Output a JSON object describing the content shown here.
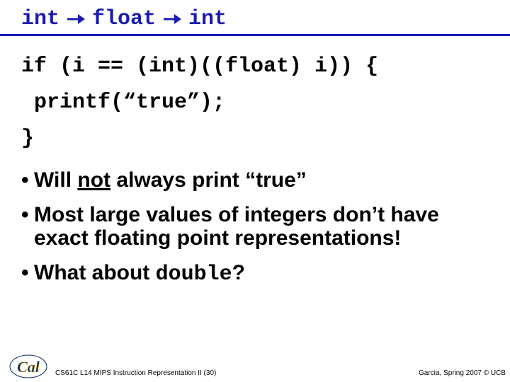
{
  "title": {
    "t1": "int",
    "t2": "float",
    "t3": "int"
  },
  "code": {
    "l1": "if (i == (int)((float) i)) {",
    "l2": "printf(“true”);",
    "l3": "}"
  },
  "bullets": {
    "b1_pre": "Will ",
    "b1_not": "not",
    "b1_post": " always print “true”",
    "b2": "Most large values of integers don’t have exact floating point representations!",
    "b3_pre": "What about ",
    "b3_mono": "double",
    "b3_post": "?"
  },
  "footer": {
    "left": "CS61C L14 MIPS Instruction Representation II (30)",
    "right": "Garcia, Spring 2007 © UCB"
  },
  "icons": {
    "arrow": "arrow-right"
  }
}
